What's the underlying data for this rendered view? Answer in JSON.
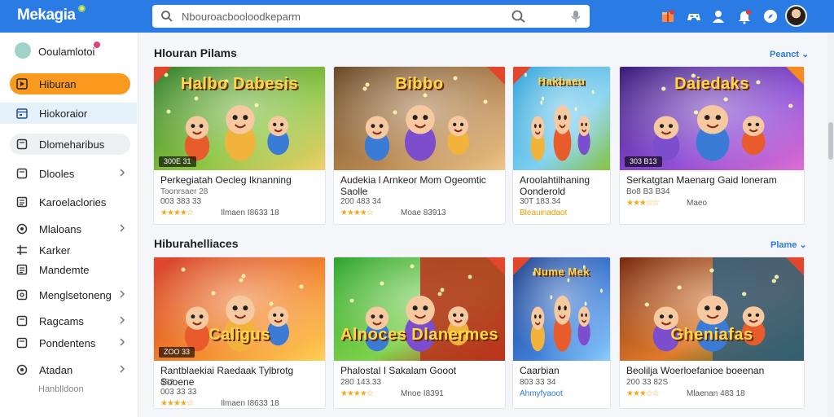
{
  "app": {
    "logo": "Mekagia"
  },
  "search": {
    "placeholder": "Nbouroacbooloodkeparm"
  },
  "sidebar": {
    "header": "Ooulamlotoi",
    "items": [
      {
        "label": "Hiburan",
        "icon": "play-icon",
        "state": "active"
      },
      {
        "label": "Hiokoraior",
        "icon": "calendar-icon",
        "state": "selected"
      },
      {
        "label": "Dlomeharibus",
        "icon": "square-icon",
        "state": "grey"
      },
      {
        "label": "Dlooles",
        "icon": "square-icon",
        "chevron": true
      },
      {
        "label": "Karoelaclories",
        "icon": "list-icon"
      },
      {
        "label": "Mlaloans",
        "icon": "circle-icon",
        "chevron": true
      },
      {
        "label": "Karker",
        "icon": "grid-icon"
      },
      {
        "label": "Mandemte",
        "icon": "list-icon"
      },
      {
        "label": "Menglsetoneng",
        "icon": "tag-icon",
        "chevron": true
      },
      {
        "label": "Ragcams",
        "icon": "square-icon",
        "chevron": true
      },
      {
        "label": "Pondentens",
        "icon": "square-icon",
        "chevron": true
      },
      {
        "label": "Atadan",
        "icon": "circle-icon",
        "chevron": true
      }
    ],
    "footer": "Hanblldoon"
  },
  "sections": [
    {
      "title": "Hlouran Pilams",
      "more": "Peanct",
      "cards": [
        {
          "poster": "Halbo Dabesis",
          "badge": "300E 31",
          "title": "Perkegiatah Oecleg Iknanning",
          "sub": "Toonrsaer 28",
          "dev": "003 383 33",
          "stars": "★★★★☆",
          "meta": "Ilmaen I8633 18",
          "corner": "#e2462c",
          "scene": 0
        },
        {
          "poster": "Bibbo",
          "badge": "",
          "title": "Audekia l Arnkeor Mom Ogeomtic Saolle",
          "sub": "",
          "dev": "200 483 34",
          "stars": "★★★★☆",
          "meta": "Moae 83913",
          "corner": "#e2462c",
          "scene": 1
        },
        {
          "poster": "Hakbaeu",
          "badge": "",
          "title": "Aroolahtilhaning Oonderold",
          "sub": "",
          "dev": "30T 183.34",
          "orange": "Bleauinadaot",
          "corner": "#e2462c",
          "scene": 2
        },
        {
          "poster": "Daiedaks",
          "badge": "303 B13",
          "title": "Serkatgtan Maenarg Gaid Ioneram",
          "sub": "",
          "dev": "Bo8 B3 B34",
          "stars": "★★★☆☆",
          "meta": "Maeo",
          "corner": "#f58a1e",
          "scene": 3
        }
      ]
    },
    {
      "title": "Hiburahelliaces",
      "more": "Plame",
      "cards": [
        {
          "poster": "Caligus",
          "badge": "ZOO 33",
          "title": "Rantblaekiai Raedaak Tylbrotg Sooene",
          "sub": "483",
          "dev": "003 33 33",
          "stars": "★★★★☆",
          "meta": "Ilmaen I8633 18",
          "corner": "#e2462c",
          "scene": 4
        },
        {
          "poster": "Alnoces Dlanermes",
          "badge": "",
          "title": "Phalostal I Sakalam Gooot",
          "sub": "",
          "dev": "280 143.33",
          "stars": "★★★★☆",
          "meta": "Mnoe I8391",
          "corner": "#e2462c",
          "scene": 5
        },
        {
          "poster": "Nume Mek",
          "badge": "",
          "title": "Caarbian",
          "sub": "",
          "dev": "803 33 34",
          "blue": "Ahmyfyaoot",
          "corner": "#e2462c",
          "scene": 6
        },
        {
          "poster": "Gheniafas",
          "badge": "",
          "title": "Beolilja Woerloefanioe boeenan",
          "sub": "",
          "dev": "200 33 82S",
          "stars": "★★★☆☆",
          "meta": "Mlaenan 483 18",
          "corner": "#e2462c",
          "scene": 7
        }
      ]
    }
  ]
}
